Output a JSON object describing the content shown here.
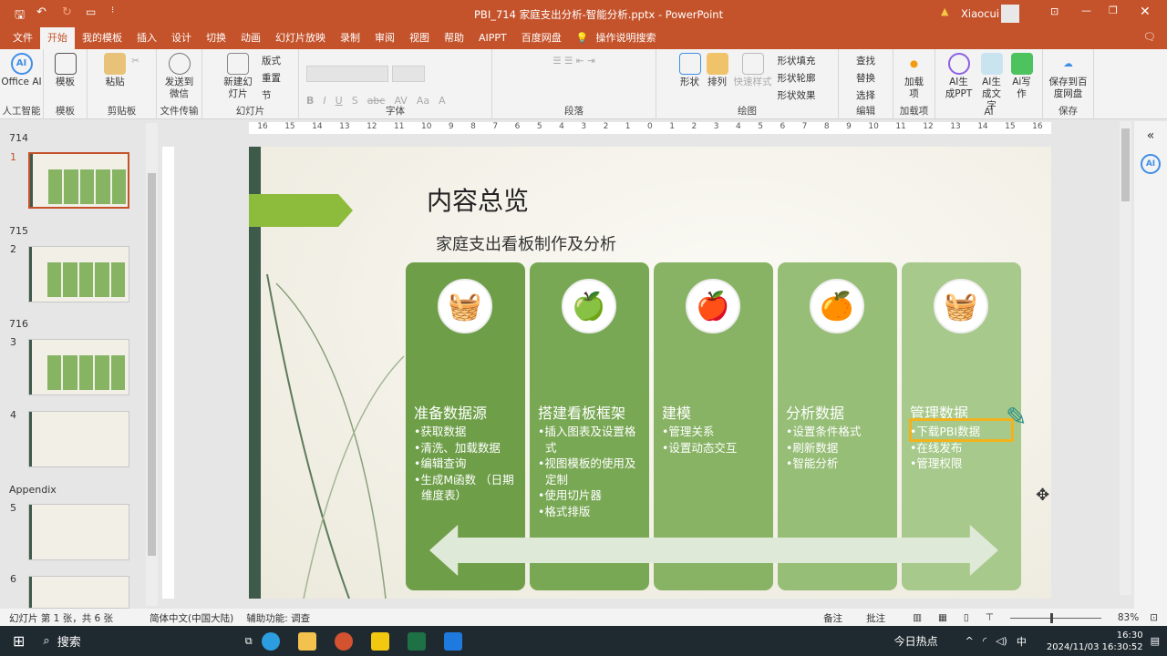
{
  "title_bar": {
    "title": "PBI_714 家庭支出分析-智能分析.pptx  -  PowerPoint",
    "user": "Xiaocui",
    "qat": [
      "save-icon",
      "undo-icon",
      "redo-icon",
      "present-icon",
      "customize-icon"
    ]
  },
  "tabs": [
    "文件",
    "开始",
    "我的模板",
    "插入",
    "设计",
    "切换",
    "动画",
    "幻灯片放映",
    "录制",
    "审阅",
    "视图",
    "帮助",
    "AIPPT",
    "百度网盘",
    "操作说明搜索"
  ],
  "active_tab": "开始",
  "ribbon": {
    "groups": [
      {
        "label": "人工智能",
        "buttons": [
          "Office AI"
        ]
      },
      {
        "label": "模板",
        "buttons": [
          "模板"
        ]
      },
      {
        "label": "剪贴板",
        "buttons": [
          "粘贴"
        ]
      },
      {
        "label": "文件传输",
        "buttons": [
          "发送到微信"
        ]
      },
      {
        "label": "幻灯片",
        "buttons": [
          "新建幻灯片",
          "版式",
          "重置",
          "节"
        ]
      },
      {
        "label": "字体",
        "buttons": [
          "B",
          "I",
          "U",
          "S",
          "abc",
          "AV",
          "Aa",
          "A"
        ]
      },
      {
        "label": "段落",
        "buttons": []
      },
      {
        "label": "绘图",
        "buttons": [
          "形状",
          "排列",
          "快速样式",
          "形状填充",
          "形状轮廓",
          "形状效果"
        ]
      },
      {
        "label": "编辑",
        "buttons": [
          "查找",
          "替换",
          "选择"
        ]
      },
      {
        "label": "加载项",
        "buttons": [
          "加载项"
        ]
      },
      {
        "label": "AI",
        "buttons": [
          "AI生成PPT",
          "AI生成文字",
          "Ai写作"
        ]
      },
      {
        "label": "保存",
        "buttons": [
          "保存到百度网盘"
        ]
      }
    ]
  },
  "ruler": {
    "h_ticks": [
      "16",
      "15",
      "14",
      "13",
      "12",
      "11",
      "10",
      "9",
      "8",
      "7",
      "6",
      "5",
      "4",
      "3",
      "2",
      "1",
      "0",
      "1",
      "2",
      "3",
      "4",
      "5",
      "6",
      "7",
      "8",
      "9",
      "10",
      "11",
      "12",
      "13",
      "14",
      "15",
      "16"
    ]
  },
  "slides_pane": {
    "sections": [
      "714",
      "715",
      "716",
      "Appendix"
    ],
    "slides": [
      {
        "num": "1",
        "selected": true
      },
      {
        "num": "2"
      },
      {
        "num": "3"
      },
      {
        "num": "4"
      },
      {
        "num": "5"
      },
      {
        "num": "6"
      }
    ]
  },
  "slide": {
    "title": "内容总览",
    "subtitle": "家庭支出看板制作及分析",
    "cards": [
      {
        "title": "准备数据源",
        "items": [
          "•获取数据",
          "•清洗、加载数据",
          "•编辑查询",
          "•生成M函数 （日期维度表）"
        ],
        "color": "#6e9f48",
        "icon": "fruit-basket"
      },
      {
        "title": "搭建看板框架",
        "items": [
          "•插入图表及设置格式",
          "•视图模板的使用及定制",
          "•使用切片器",
          "•格式排版"
        ],
        "color": "#79a854",
        "icon": "apple-gray"
      },
      {
        "title": "建模",
        "items": [
          "•管理关系",
          "•设置动态交互"
        ],
        "color": "#88b364",
        "icon": "red-apple"
      },
      {
        "title": "分析数据",
        "items": [
          "•设置条件格式",
          "•刷新数据",
          "•智能分析"
        ],
        "color": "#97be77",
        "icon": "oranges"
      },
      {
        "title": "管理数据",
        "items": [
          "•下载PBI数据",
          "•在线发布",
          "•管理权限"
        ],
        "color": "#a7c98b",
        "icon": "fruit-basket"
      }
    ],
    "highlight_color": "#f2b21c"
  },
  "status_bar": {
    "slide_info": "幻灯片 第 1 张，共 6 张",
    "language": "简体中文(中国大陆)",
    "accessibility": "辅助功能: 调查",
    "notes": "备注",
    "comments": "批注",
    "zoom": "83%"
  },
  "taskbar": {
    "search": "搜索",
    "news": "今日热点",
    "ime": "中",
    "time": "16:30",
    "date": "2024/11/03 16:30:52"
  }
}
